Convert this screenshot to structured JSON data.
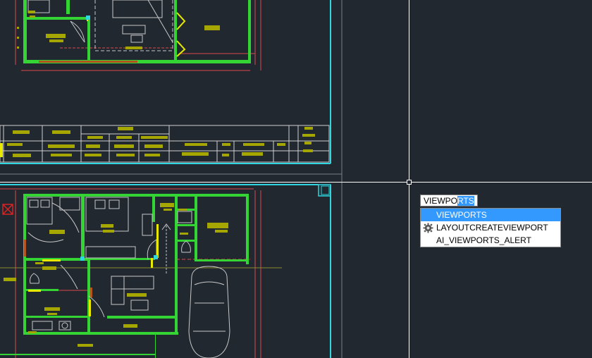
{
  "command_line": {
    "typed_text": "VIEWPO",
    "autocomplete_text": "RTS"
  },
  "suggestions": [
    {
      "label": "VIEWPORTS",
      "icon": null,
      "selected": true
    },
    {
      "label": "LAYOUTCREATEVIEWPORT",
      "icon": "gear-icon",
      "selected": false
    },
    {
      "label": "AI_VIEWPORTS_ALERT",
      "icon": null,
      "selected": false
    }
  ],
  "colors": {
    "background": "#212830",
    "wall_green": "#35d435",
    "furniture_gray": "#c8c8c8",
    "label_olive": "#a6a600",
    "dimension_red": "#d94a4a",
    "frame_cyan": "#2fd6e0",
    "highlight_yellow": "#e8e800",
    "selection_blue": "#3399ff",
    "crosshair": "#ffffff"
  }
}
